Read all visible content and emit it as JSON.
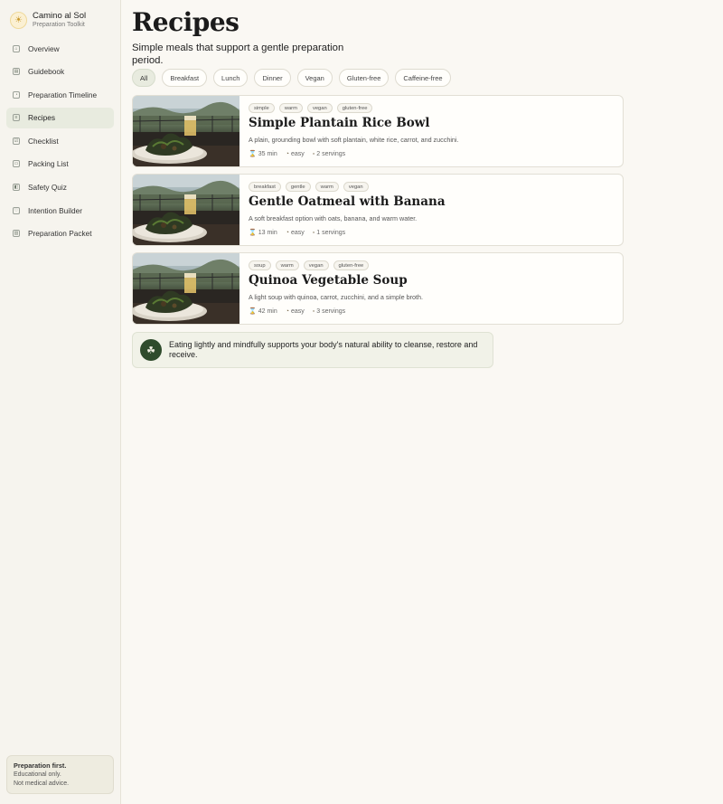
{
  "brand": {
    "name": "Camino al Sol",
    "subtitle": "Preparation Toolkit",
    "icon": "sun-icon"
  },
  "nav": [
    {
      "label": "Overview",
      "icon": "home-icon",
      "glyph": "⌂",
      "active": false
    },
    {
      "label": "Guidebook",
      "icon": "book-icon",
      "glyph": "▤",
      "active": false
    },
    {
      "label": "Preparation Timeline",
      "icon": "timeline-icon",
      "glyph": "◔",
      "active": false
    },
    {
      "label": "Recipes",
      "icon": "recipe-icon",
      "glyph": "≡",
      "active": true
    },
    {
      "label": "Checklist",
      "icon": "checklist-icon",
      "glyph": "☑",
      "active": false
    },
    {
      "label": "Packing List",
      "icon": "bag-icon",
      "glyph": "▭",
      "active": false
    },
    {
      "label": "Safety Quiz",
      "icon": "shield-icon",
      "glyph": "◧",
      "active": false
    },
    {
      "label": "Intention Builder",
      "icon": "heart-icon",
      "glyph": "♡",
      "active": false
    },
    {
      "label": "Preparation Packet",
      "icon": "packet-icon",
      "glyph": "▥",
      "active": false
    }
  ],
  "sidebar_note": {
    "title": "Preparation first.",
    "line1": "Educational only.",
    "line2": "Not medical advice."
  },
  "page": {
    "title": "Recipes",
    "subtitle": "Simple meals that support a gentle preparation period."
  },
  "filters": [
    {
      "label": "All",
      "active": true
    },
    {
      "label": "Breakfast",
      "active": false
    },
    {
      "label": "Lunch",
      "active": false
    },
    {
      "label": "Dinner",
      "active": false
    },
    {
      "label": "Vegan",
      "active": false
    },
    {
      "label": "Gluten-free",
      "active": false
    },
    {
      "label": "Caffeine-free",
      "active": false
    }
  ],
  "recipes": [
    {
      "tags": [
        "simple",
        "warm",
        "vegan",
        "gluten-free"
      ],
      "title": "Simple Plantain Rice Bowl",
      "description": "A plain, grounding bowl with soft plantain, white rice, carrot, and zucchini.",
      "time": "35 min",
      "difficulty": "easy",
      "servings": "2 servings"
    },
    {
      "tags": [
        "breakfast",
        "gentle",
        "warm",
        "vegan"
      ],
      "title": "Gentle Oatmeal with Banana",
      "description": "A soft breakfast option with oats, banana, and warm water.",
      "time": "13 min",
      "difficulty": "easy",
      "servings": "1 servings"
    },
    {
      "tags": [
        "soup",
        "warm",
        "vegan",
        "gluten-free"
      ],
      "title": "Quinoa Vegetable Soup",
      "description": "A light soup with quinoa, carrot, zucchini, and a simple broth.",
      "time": "42 min",
      "difficulty": "easy",
      "servings": "3 servings"
    }
  ],
  "callout": {
    "icon": "leaf-icon",
    "text": "Eating lightly and mindfully supports your body's natural ability to cleanse, restore and receive."
  },
  "colors": {
    "accent": "#2f4b2c",
    "active_bg": "#e8ebdf",
    "background": "#faf8f3"
  }
}
